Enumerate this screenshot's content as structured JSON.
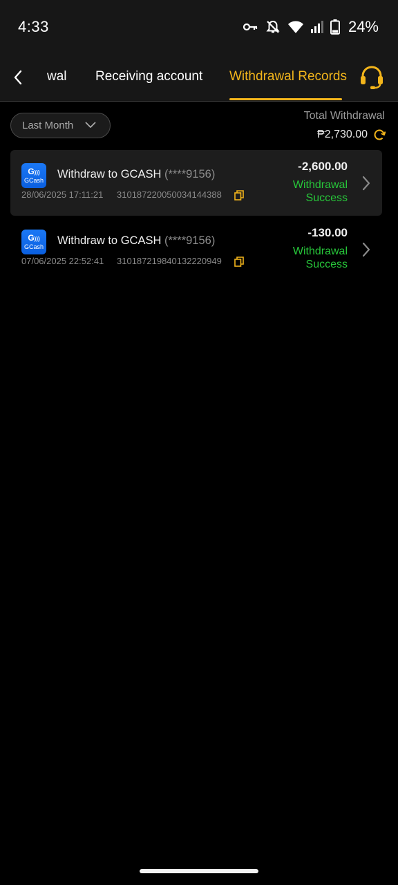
{
  "status_bar": {
    "time": "4:33",
    "battery": "24%",
    "icons": [
      "vpn-key-icon",
      "notifications-off-icon",
      "wifi-icon",
      "signal-icon",
      "battery-icon"
    ]
  },
  "tabs": {
    "partial_label": "wal",
    "receiving_label": "Receiving account",
    "records_label": "Withdrawal Records",
    "active": "Withdrawal Records"
  },
  "filter": {
    "label": "Last Month"
  },
  "total": {
    "label": "Total Withdrawal",
    "amount": "₱2,730.00"
  },
  "records": [
    {
      "logo_text": "GCash",
      "title": "Withdraw to GCASH",
      "account": "(****9156)",
      "datetime": "28/06/2025 17:11:21",
      "transaction_id": "310187220050034144388",
      "amount": "-2,600.00",
      "status": "Withdrawal Success"
    },
    {
      "logo_text": "GCash",
      "title": "Withdraw to GCASH",
      "account": "(****9156)",
      "datetime": "07/06/2025 22:52:41",
      "transaction_id": "310187219840132220949",
      "amount": "-130.00",
      "status": "Withdrawal Success"
    }
  ],
  "colors": {
    "accent": "#f3b51b",
    "success": "#27c63a",
    "background": "#000000",
    "header": "#171717",
    "gcash_blue": "#1b78f5"
  }
}
